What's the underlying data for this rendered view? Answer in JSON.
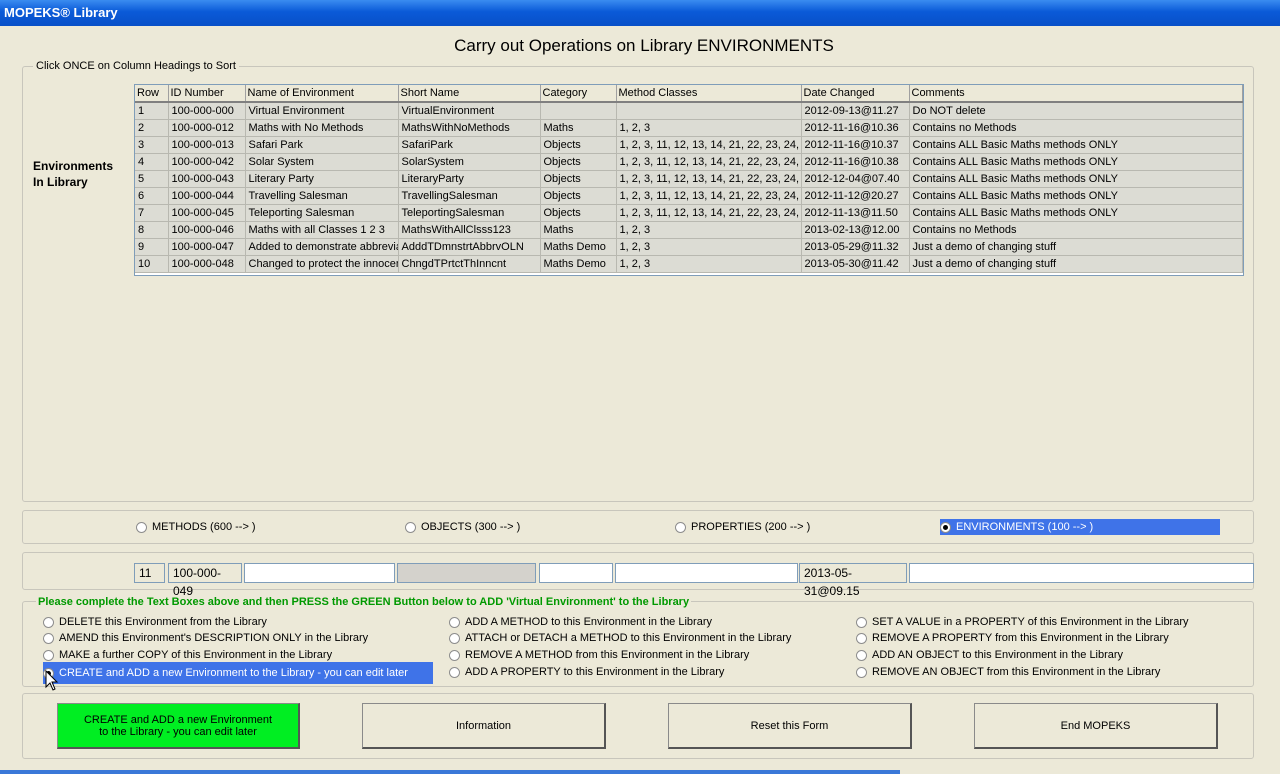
{
  "window": {
    "title": "MOPEKS® Library"
  },
  "page": {
    "heading": "Carry out Operations on Library ENVIRONMENTS"
  },
  "library_group": {
    "legend": "Click ONCE on Column Headings to Sort",
    "label_line1": "Environments",
    "label_line2": "In Library"
  },
  "table": {
    "columns": [
      "Row",
      "ID Number",
      "Name of Environment",
      "Short Name",
      "Category",
      "Method Classes",
      "Date Changed",
      "Comments"
    ],
    "rows": [
      [
        "1",
        "100-000-000",
        "Virtual Environment",
        "VirtualEnvironment",
        "",
        "",
        "2012-09-13@11.27",
        "Do NOT delete"
      ],
      [
        "2",
        "100-000-012",
        "Maths with No Methods",
        "MathsWithNoMethods",
        "Maths",
        "1, 2, 3",
        "2012-11-16@10.36",
        "Contains no Methods"
      ],
      [
        "3",
        "100-000-013",
        "Safari Park",
        "SafariPark",
        "Objects",
        "1, 2, 3, 11, 12, 13, 14, 21, 22, 23, 24,",
        "2012-11-16@10.37",
        "Contains ALL Basic Maths methods ONLY"
      ],
      [
        "4",
        "100-000-042",
        "Solar System",
        "SolarSystem",
        "Objects",
        "1, 2, 3, 11, 12, 13, 14, 21, 22, 23, 24,",
        "2012-11-16@10.38",
        "Contains ALL Basic Maths methods ONLY"
      ],
      [
        "5",
        "100-000-043",
        "Literary Party",
        "LiteraryParty",
        "Objects",
        "1, 2, 3, 11, 12, 13, 14, 21, 22, 23, 24,",
        "2012-12-04@07.40",
        "Contains ALL Basic Maths methods ONLY"
      ],
      [
        "6",
        "100-000-044",
        "Travelling Salesman",
        "TravellingSalesman",
        "Objects",
        "1, 2, 3, 11, 12, 13, 14, 21, 22, 23, 24,",
        "2012-11-12@20.27",
        "Contains ALL Basic Maths methods ONLY"
      ],
      [
        "7",
        "100-000-045",
        "Teleporting Salesman",
        "TeleportingSalesman",
        "Objects",
        "1, 2, 3, 11, 12, 13, 14, 21, 22, 23, 24,",
        "2012-11-13@11.50",
        "Contains ALL Basic Maths methods ONLY"
      ],
      [
        "8",
        "100-000-046",
        "Maths with all Classes 1 2 3",
        "MathsWithAllClsss123",
        "Maths",
        "1, 2, 3",
        "2013-02-13@12.00",
        "Contains no Methods"
      ],
      [
        "9",
        "100-000-047",
        "Added to demonstrate abbrevia",
        "AdddTDmnstrtAbbrvOLN",
        "Maths Demo",
        "1, 2, 3",
        "2013-05-29@11.32",
        "Just a demo of changing stuff"
      ],
      [
        "10",
        "100-000-048",
        "Changed to protect the innocen",
        "ChngdTPrtctThInncnt",
        "Maths Demo",
        "1, 2, 3",
        "2013-05-30@11.42",
        "Just a demo of changing stuff"
      ]
    ]
  },
  "library_type": {
    "options": [
      "METHODS (600 --> )",
      "OBJECTS (300 --> )",
      "PROPERTIES (200 --> )",
      "ENVIRONMENTS (100 --> )"
    ],
    "selected": "ENVIRONMENTS (100 --> )"
  },
  "new_row": {
    "row": "11",
    "id": "100-000-049",
    "name": "",
    "short_name": "",
    "category": "",
    "method_classes": "",
    "date": "2013-05-31@09.15",
    "comments": ""
  },
  "operations": {
    "instruction": "Please complete the Text Boxes above and then PRESS the GREEN Button below to ADD 'Virtual Environment' to the Library",
    "col1": [
      "DELETE this Environment from the Library",
      "AMEND this Environment's DESCRIPTION ONLY in the Library",
      "MAKE a further COPY of this Environment in the Library",
      "CREATE and ADD a new Environment to the Library - you can edit later"
    ],
    "col2": [
      "ADD A METHOD to this Environment in the Library",
      "ATTACH or DETACH a METHOD to this Environment in the Library",
      "REMOVE A METHOD from this Environment in the Library",
      "ADD A PROPERTY to this Environment in the Library"
    ],
    "col3": [
      "SET A VALUE in a PROPERTY of this Environment in the Library",
      "REMOVE A PROPERTY from this Environment in the Library",
      "ADD AN OBJECT to this Environment in the Library",
      "REMOVE  AN OBJECT from this Environment in the Library"
    ],
    "selected": "CREATE and ADD a new Environment to the Library - you can edit later"
  },
  "buttons": {
    "create_line1": "CREATE and ADD a new Environment",
    "create_line2": "to the Library - you can edit later",
    "information": "Information",
    "reset": "Reset this Form",
    "end": "End MOPEKS"
  },
  "colors": {
    "accent": "#3f73e8",
    "action_green": "#00ee22",
    "instruction_green": "#009900",
    "title_blue": "#0a5ad8"
  }
}
